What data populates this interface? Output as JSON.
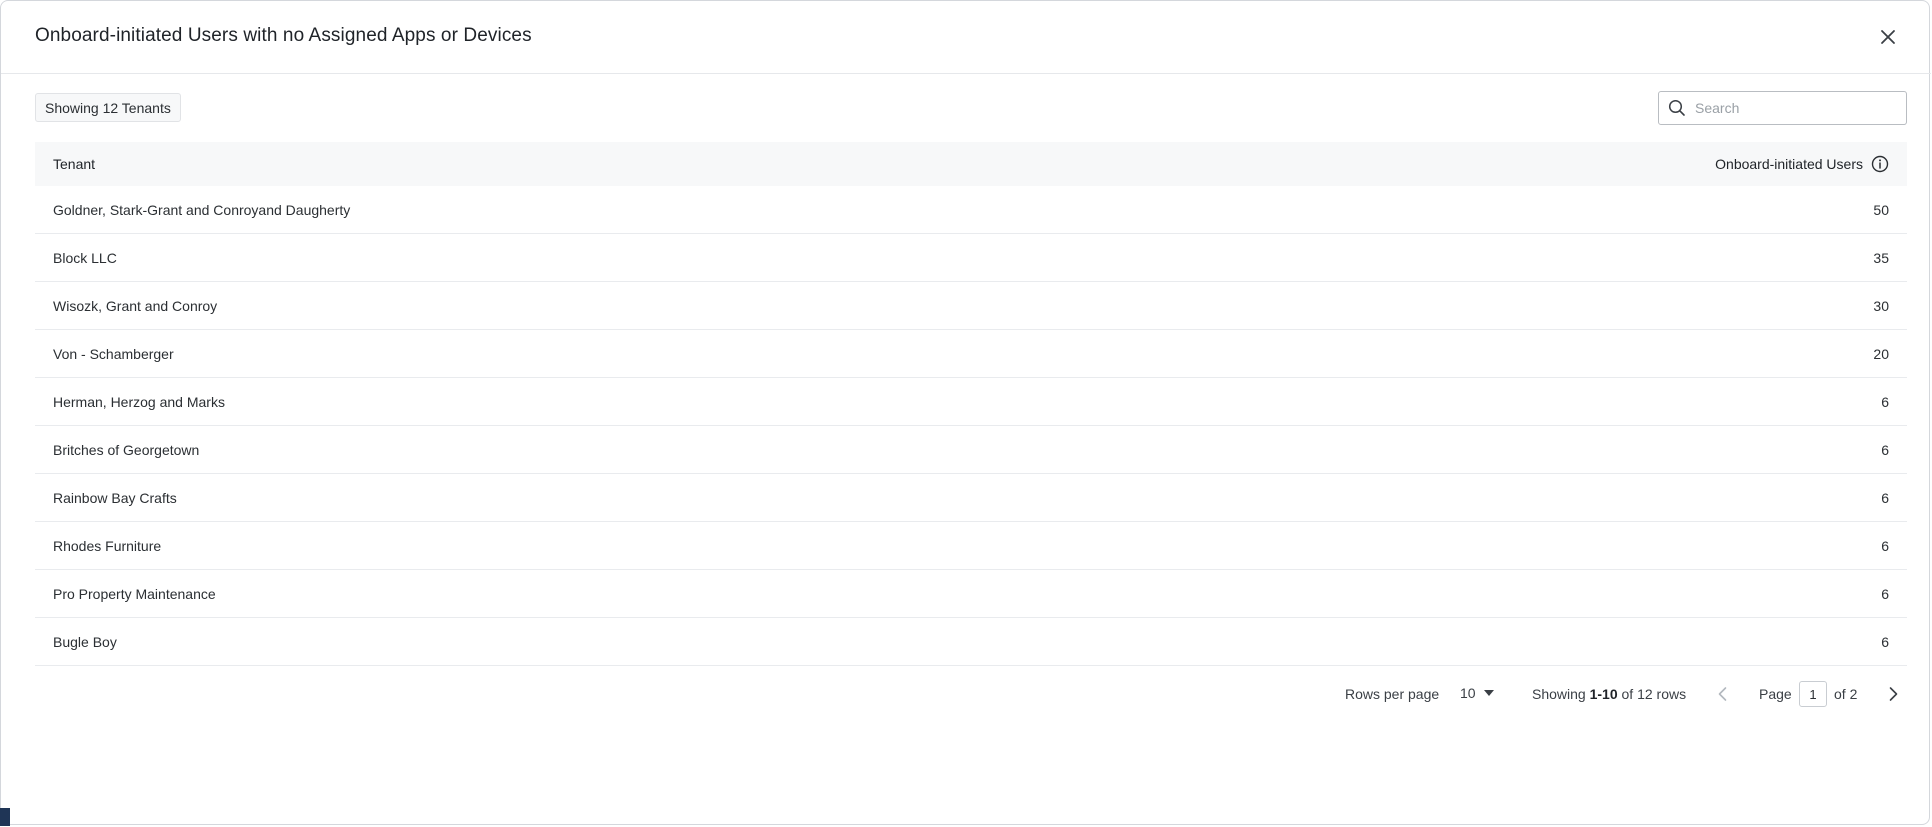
{
  "modal": {
    "title": "Onboard-initiated Users with no Assigned Apps or Devices",
    "close_icon": "close-icon"
  },
  "toolbar": {
    "count_label": "Showing 12 Tenants",
    "search_placeholder": "Search",
    "search_value": "",
    "search_icon": "search-icon"
  },
  "table": {
    "columns": {
      "tenant": "Tenant",
      "users": "Onboard-initiated Users",
      "users_info_icon": "info-icon"
    },
    "rows": [
      {
        "tenant": "Goldner, Stark-Grant and Conroyand Daugherty",
        "users": "50"
      },
      {
        "tenant": "Block LLC",
        "users": "35"
      },
      {
        "tenant": "Wisozk, Grant and Conroy",
        "users": "30"
      },
      {
        "tenant": "Von - Schamberger",
        "users": "20"
      },
      {
        "tenant": "Herman, Herzog and Marks",
        "users": "6"
      },
      {
        "tenant": "Britches of Georgetown",
        "users": "6"
      },
      {
        "tenant": "Rainbow Bay Crafts",
        "users": "6"
      },
      {
        "tenant": "Rhodes Furniture",
        "users": "6"
      },
      {
        "tenant": "Pro Property Maintenance",
        "users": "6"
      },
      {
        "tenant": "Bugle Boy",
        "users": "6"
      }
    ]
  },
  "pagination": {
    "rows_per_page_label": "Rows per page",
    "rows_per_page_value": "10",
    "showing_prefix": "Showing",
    "showing_range": "1-10",
    "showing_suffix": "of 12 rows",
    "page_label": "Page",
    "current_page": "1",
    "of_pages": "of 2"
  },
  "colors": {
    "header_bg": "#f7f8f9",
    "border": "#e9ebee",
    "text": "#1f2328",
    "corner_marker": "#1f3556"
  }
}
